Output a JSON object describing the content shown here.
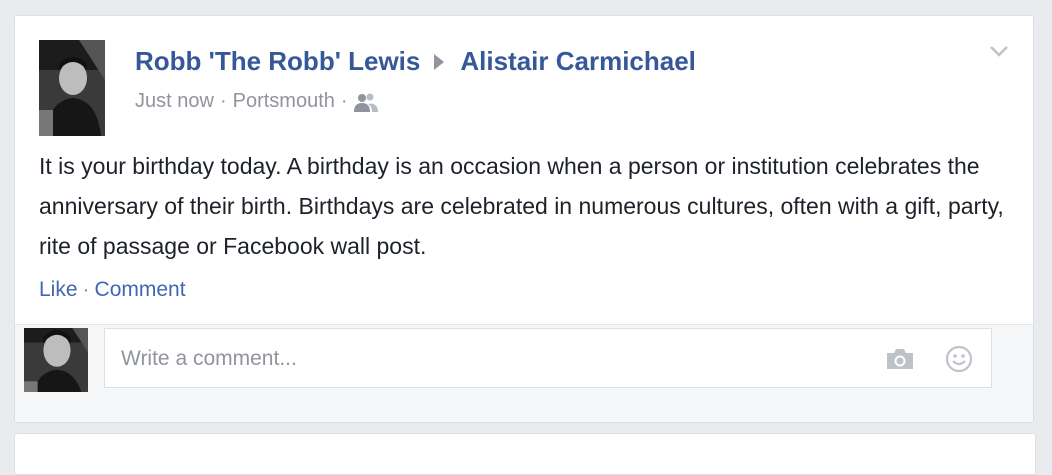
{
  "post": {
    "author": "Robb 'The Robb' Lewis",
    "target": "Alistair Carmichael",
    "time": "Just now",
    "location": "Portsmouth",
    "separator": "·",
    "audience_icon": "friends-icon",
    "text": "It is your birthday today. A birthday is an occasion when a person or institution celebrates the anniversary of their birth. Birthdays are celebrated in numerous cultures, often with a gift, party, rite of passage or Facebook wall post."
  },
  "actions": {
    "like": "Like",
    "separator": "·",
    "comment": "Comment"
  },
  "comment_box": {
    "placeholder": "Write a comment...",
    "camera_icon": "camera-icon",
    "emoji_icon": "smiley-icon"
  },
  "colors": {
    "link": "#365899",
    "action": "#4267b2",
    "meta": "#90949c",
    "text": "#1d2129",
    "page_bg": "#e9ebee"
  }
}
